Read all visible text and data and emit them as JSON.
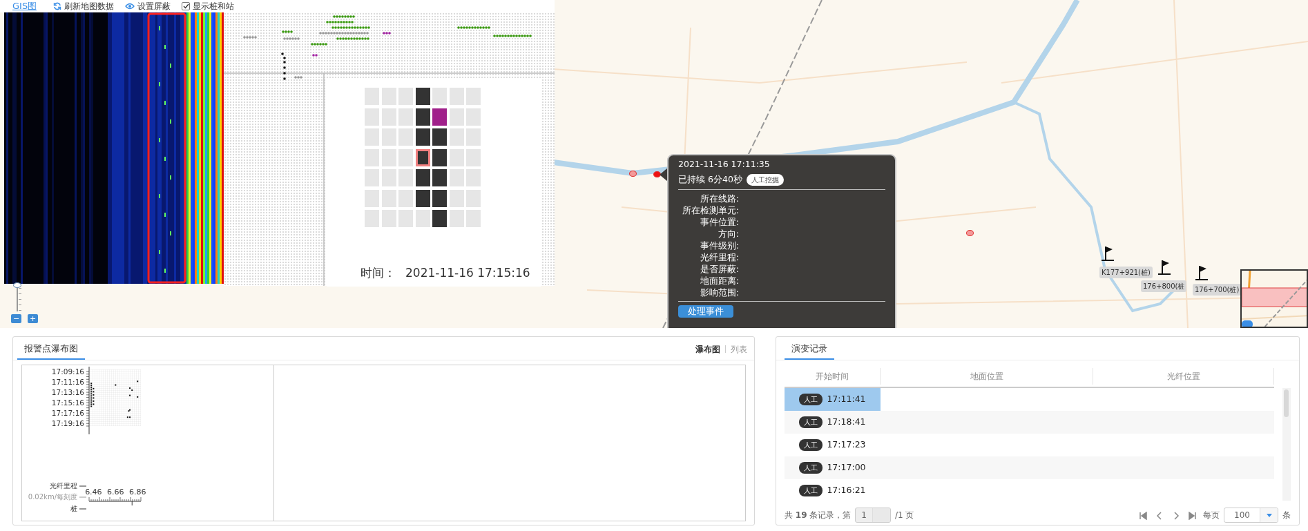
{
  "toolbar": {
    "title": "GIS图",
    "actions": [
      {
        "kind": "refresh",
        "label": "刷新地图数据"
      },
      {
        "kind": "eye",
        "label": "设置屏蔽"
      },
      {
        "kind": "checkbox",
        "label": "显示桩和站",
        "checked": true
      }
    ]
  },
  "inspector": {
    "time_label": "时间：",
    "time": "2021-11-16 17:15:16",
    "cell_grid": [
      {
        "cells": [
          {
            "kind": "empty"
          },
          {
            "kind": "empty"
          },
          {
            "kind": "empty"
          },
          {
            "kind": "dark"
          },
          {
            "kind": "empty"
          },
          {
            "kind": "empty"
          },
          {
            "kind": "empty"
          }
        ]
      },
      {
        "cells": [
          {
            "kind": "empty"
          },
          {
            "kind": "empty"
          },
          {
            "kind": "empty"
          },
          {
            "kind": "dark"
          },
          {
            "kind": "magenta"
          },
          {
            "kind": "empty"
          },
          {
            "kind": "empty"
          }
        ]
      },
      {
        "cells": [
          {
            "kind": "empty"
          },
          {
            "kind": "empty"
          },
          {
            "kind": "empty"
          },
          {
            "kind": "dark"
          },
          {
            "kind": "dark"
          },
          {
            "kind": "empty"
          },
          {
            "kind": "empty"
          }
        ]
      },
      {
        "cells": [
          {
            "kind": "empty"
          },
          {
            "kind": "empty"
          },
          {
            "kind": "empty"
          },
          {
            "kind": "selected"
          },
          {
            "kind": "dark"
          },
          {
            "kind": "empty"
          },
          {
            "kind": "empty"
          }
        ]
      },
      {
        "cells": [
          {
            "kind": "empty"
          },
          {
            "kind": "empty"
          },
          {
            "kind": "empty"
          },
          {
            "kind": "dark"
          },
          {
            "kind": "dark"
          },
          {
            "kind": "empty"
          },
          {
            "kind": "empty"
          }
        ]
      },
      {
        "cells": [
          {
            "kind": "empty"
          },
          {
            "kind": "empty"
          },
          {
            "kind": "empty"
          },
          {
            "kind": "dark"
          },
          {
            "kind": "dark"
          },
          {
            "kind": "empty"
          },
          {
            "kind": "empty"
          }
        ]
      },
      {
        "cells": [
          {
            "kind": "empty"
          },
          {
            "kind": "empty"
          },
          {
            "kind": "empty"
          },
          {
            "kind": "empty"
          },
          {
            "kind": "dark"
          },
          {
            "kind": "empty"
          },
          {
            "kind": "empty"
          }
        ]
      }
    ]
  },
  "map": {
    "zoom": {
      "level": 0.95,
      "buttons": [
        "−",
        "+"
      ]
    },
    "piles": [
      {
        "label": "K177+921(桩)"
      },
      {
        "label": "176+800(桩"
      },
      {
        "label": "176+700(桩)"
      }
    ],
    "popup": {
      "time": "2021-11-16 17:11:35",
      "duration": "已持续 6分40秒",
      "tag": "人工挖掘",
      "fields": [
        {
          "label": "所在线路:"
        },
        {
          "label": "所在检测单元:"
        },
        {
          "label": "事件位置:"
        },
        {
          "label": "方向:"
        },
        {
          "label": "事件级别:"
        },
        {
          "label": "光纤里程:"
        },
        {
          "label": "是否屏蔽:"
        },
        {
          "label": "地面距离:"
        },
        {
          "label": "影响范围:"
        }
      ],
      "button": "处理事件"
    }
  },
  "alarm_panel": {
    "tabs": [
      {
        "label": "报警点瀑布图",
        "selected": true
      }
    ],
    "views": [
      {
        "label": "瀑布图",
        "selected": true
      },
      {
        "label": "列表",
        "selected": false
      }
    ],
    "axis_labels": [
      "光纤里程",
      "0.02km/每刻度",
      "桩"
    ],
    "time_ticks": [
      "17:09:16",
      "17:11:16",
      "17:13:16",
      "17:15:16",
      "17:17:16",
      "17:19:16"
    ],
    "mileage_ticks": [
      "6.46",
      "6.66",
      "6.86"
    ]
  },
  "history_panel": {
    "tabs": [
      {
        "label": "演变记录",
        "selected": true
      }
    ],
    "columns": [
      "开始时间",
      "地面位置",
      "光纤位置"
    ],
    "rows": [
      {
        "tag": "人工",
        "time": "17:11:41",
        "selected": true
      },
      {
        "tag": "人工",
        "time": "17:18:41",
        "selected": false
      },
      {
        "tag": "人工",
        "time": "17:17:23",
        "selected": false
      },
      {
        "tag": "人工",
        "time": "17:17:00",
        "selected": false
      },
      {
        "tag": "人工",
        "time": "17:16:21",
        "selected": false
      }
    ],
    "pager": {
      "summary": "共 **19** 条记录，第",
      "page": "1",
      "pages": "/1 页",
      "per_page_label": "每页",
      "per_page": "100",
      "unit": "条"
    }
  }
}
